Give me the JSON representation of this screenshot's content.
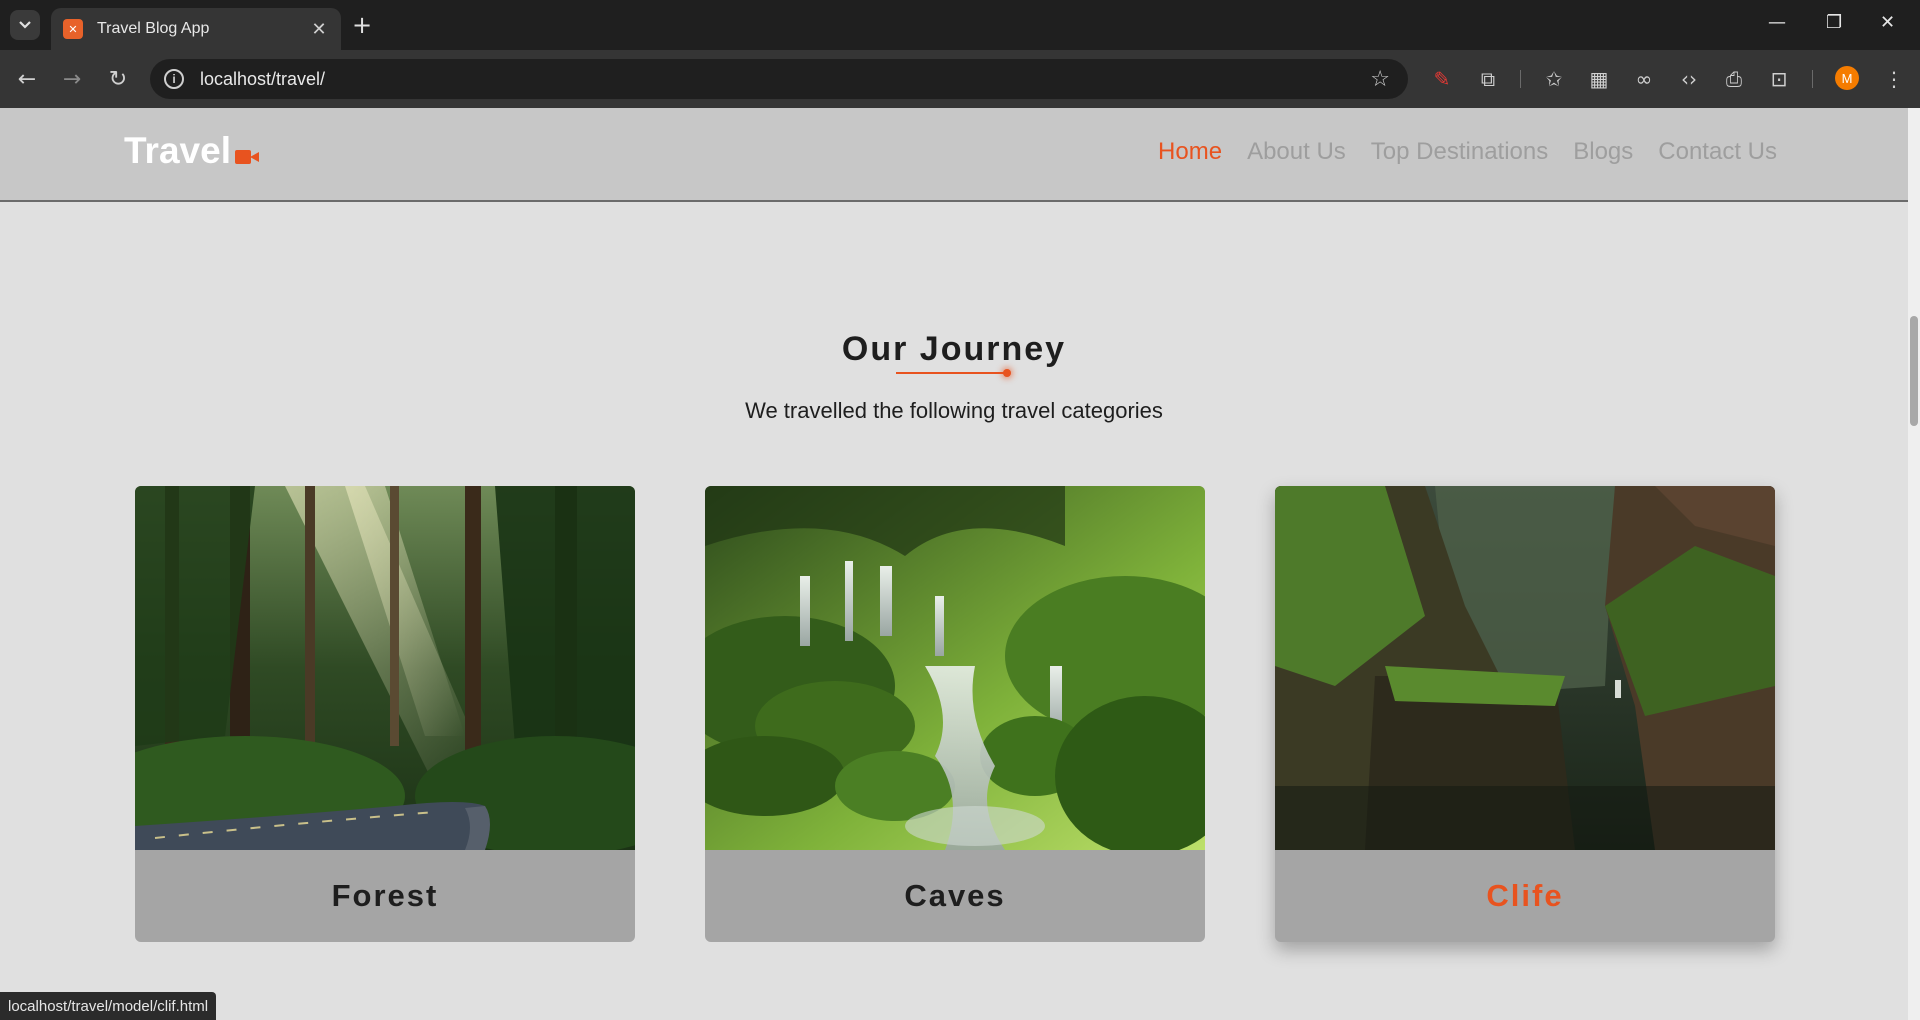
{
  "browser": {
    "tab_title": "Travel Blog App",
    "url": "localhost/travel/",
    "profile_initial": "M",
    "status_url": "localhost/travel/model/clif.html"
  },
  "site": {
    "logo_text": "Travel",
    "nav": [
      "Home",
      "About Us",
      "Top Destinations",
      "Blogs",
      "Contact Us"
    ],
    "active_nav": "Home",
    "accent_color": "#e8531f"
  },
  "section": {
    "title": "Our Journey",
    "subtitle": "We travelled the following travel categories"
  },
  "cards": [
    {
      "label": "Forest",
      "image": "forest-road-image"
    },
    {
      "label": "Caves",
      "image": "waterfall-moss-image"
    },
    {
      "label": "Clife",
      "image": "canyon-cliff-image",
      "hovered": true
    }
  ]
}
